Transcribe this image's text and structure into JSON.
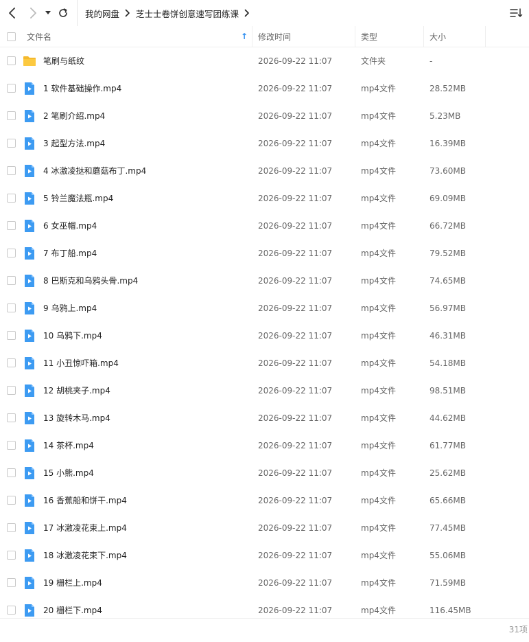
{
  "toolbar": {
    "back_icon": "chevron-left-icon",
    "forward_icon": "chevron-right-icon",
    "history_icon": "caret-down-icon",
    "refresh_icon": "refresh-icon",
    "sort_icon": "sort-list-icon"
  },
  "breadcrumb": {
    "items": [
      "我的网盘",
      "芝士士卷饼创意速写团练课"
    ]
  },
  "columns": {
    "name": "文件名",
    "mtime": "修改时间",
    "type": "类型",
    "size": "大小",
    "sort_indicator": "↑"
  },
  "colors": {
    "folder": "#f5b92d",
    "video": "#3d9bf2",
    "sort_arrow": "#2b8cf0"
  },
  "files": [
    {
      "name": "笔刷与纸纹",
      "mtime": "2026-09-22 11:07",
      "type": "文件夹",
      "size": "-",
      "icon": "folder-icon"
    },
    {
      "name": "1 软件基础操作.mp4",
      "mtime": "2026-09-22 11:07",
      "type": "mp4文件",
      "size": "28.52MB",
      "icon": "video-file-icon"
    },
    {
      "name": "2 笔刷介绍.mp4",
      "mtime": "2026-09-22 11:07",
      "type": "mp4文件",
      "size": "5.23MB",
      "icon": "video-file-icon"
    },
    {
      "name": "3 起型方法.mp4",
      "mtime": "2026-09-22 11:07",
      "type": "mp4文件",
      "size": "16.39MB",
      "icon": "video-file-icon"
    },
    {
      "name": "4 冰激凌挞和蘑菇布丁.mp4",
      "mtime": "2026-09-22 11:07",
      "type": "mp4文件",
      "size": "73.60MB",
      "icon": "video-file-icon"
    },
    {
      "name": "5 铃兰魔法瓶.mp4",
      "mtime": "2026-09-22 11:07",
      "type": "mp4文件",
      "size": "69.09MB",
      "icon": "video-file-icon"
    },
    {
      "name": "6 女巫帽.mp4",
      "mtime": "2026-09-22 11:07",
      "type": "mp4文件",
      "size": "66.72MB",
      "icon": "video-file-icon"
    },
    {
      "name": "7 布丁船.mp4",
      "mtime": "2026-09-22 11:07",
      "type": "mp4文件",
      "size": "79.52MB",
      "icon": "video-file-icon"
    },
    {
      "name": "8 巴斯克和乌鸦头骨.mp4",
      "mtime": "2026-09-22 11:07",
      "type": "mp4文件",
      "size": "74.65MB",
      "icon": "video-file-icon"
    },
    {
      "name": "9 乌鸦上.mp4",
      "mtime": "2026-09-22 11:07",
      "type": "mp4文件",
      "size": "56.97MB",
      "icon": "video-file-icon"
    },
    {
      "name": "10 乌鸦下.mp4",
      "mtime": "2026-09-22 11:07",
      "type": "mp4文件",
      "size": "46.31MB",
      "icon": "video-file-icon"
    },
    {
      "name": "11 小丑惊吓箱.mp4",
      "mtime": "2026-09-22 11:07",
      "type": "mp4文件",
      "size": "54.18MB",
      "icon": "video-file-icon"
    },
    {
      "name": "12 胡桃夹子.mp4",
      "mtime": "2026-09-22 11:07",
      "type": "mp4文件",
      "size": "98.51MB",
      "icon": "video-file-icon"
    },
    {
      "name": "13 旋转木马.mp4",
      "mtime": "2026-09-22 11:07",
      "type": "mp4文件",
      "size": "44.62MB",
      "icon": "video-file-icon"
    },
    {
      "name": "14 茶杯.mp4",
      "mtime": "2026-09-22 11:07",
      "type": "mp4文件",
      "size": "61.77MB",
      "icon": "video-file-icon"
    },
    {
      "name": "15 小熊.mp4",
      "mtime": "2026-09-22 11:07",
      "type": "mp4文件",
      "size": "25.62MB",
      "icon": "video-file-icon"
    },
    {
      "name": "16 香蕉船和饼干.mp4",
      "mtime": "2026-09-22 11:07",
      "type": "mp4文件",
      "size": "65.66MB",
      "icon": "video-file-icon"
    },
    {
      "name": "17 冰激凌花束上.mp4",
      "mtime": "2026-09-22 11:07",
      "type": "mp4文件",
      "size": "77.45MB",
      "icon": "video-file-icon"
    },
    {
      "name": "18 冰激凌花束下.mp4",
      "mtime": "2026-09-22 11:07",
      "type": "mp4文件",
      "size": "55.06MB",
      "icon": "video-file-icon"
    },
    {
      "name": "19 栅栏上.mp4",
      "mtime": "2026-09-22 11:07",
      "type": "mp4文件",
      "size": "71.59MB",
      "icon": "video-file-icon"
    },
    {
      "name": "20 栅栏下.mp4",
      "mtime": "2026-09-22 11:07",
      "type": "mp4文件",
      "size": "116.45MB",
      "icon": "video-file-icon"
    }
  ],
  "footer": {
    "item_count": "31项"
  }
}
